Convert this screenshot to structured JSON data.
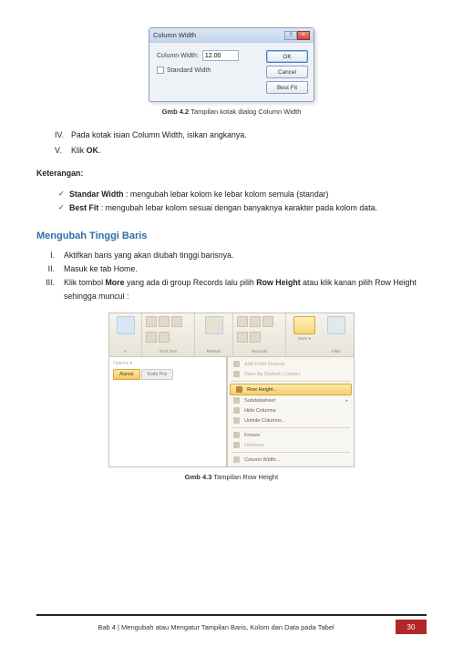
{
  "dialog": {
    "title": "Column Width",
    "label": "Column Width:",
    "value": "12.00",
    "standard": "Standard Width",
    "buttons": {
      "ok": "OK",
      "cancel": "Cancel",
      "bestfit": "Best Fit"
    }
  },
  "caption1": {
    "prefix": "Gmb 4.2",
    "text": " Tampilan kotak dialog Column Width"
  },
  "steps": {
    "iv": "Pada kotak isian Column Width, isikan angkanya.",
    "v_pre": "Klik ",
    "v_bold": "OK",
    "v_post": "."
  },
  "keterangan_label": "Keterangan:",
  "notes": {
    "standar_b": "Standar Width",
    "standar_t": " : mengubah lebar kolom ke lebar kolom semula (standar)",
    "bestfit_b": "Best Fit",
    "bestfit_t": " : mengubah lebar kolom sesuai dengan banyaknya karakter pada kolom data."
  },
  "heading": "Mengubah Tinggi Baris",
  "roman": {
    "i": "Aktifkan baris yang akan diubah tinggi barisnya.",
    "ii": "Masuk ke tab Home.",
    "iii_a": "Klik tombol ",
    "iii_b": "More",
    "iii_c": " yang ada di group Records lalu pilih ",
    "iii_d": "Row Height",
    "iii_e": " atau klik kanan pilih Row Height sehingga muncul :"
  },
  "ribbon": {
    "groups": {
      "richtext": "Rich Text",
      "records": "Records"
    },
    "tabs": {
      "t1": "Alamat",
      "t2": "Kode Pos"
    },
    "menu": {
      "addtotal": "Add From Outlook",
      "saveas": "Save As Outlook Contact",
      "rowheight": "Row Height...",
      "subdatasheet": "Subdatasheet",
      "hidecols": "Hide Columns",
      "unhidecols": "Unhide Columns...",
      "freeze": "Freeze",
      "unfreeze": "Unfreeze",
      "colwidth": "Column Width..."
    }
  },
  "caption2": {
    "prefix": "Gmb 4.3",
    "text": " Tampilan Row Height"
  },
  "footer": {
    "text": "Bab 4 | Mengubah atau Mengatur Tampilan Baris, Kolom dan Data pada Tabel",
    "page": "30"
  }
}
